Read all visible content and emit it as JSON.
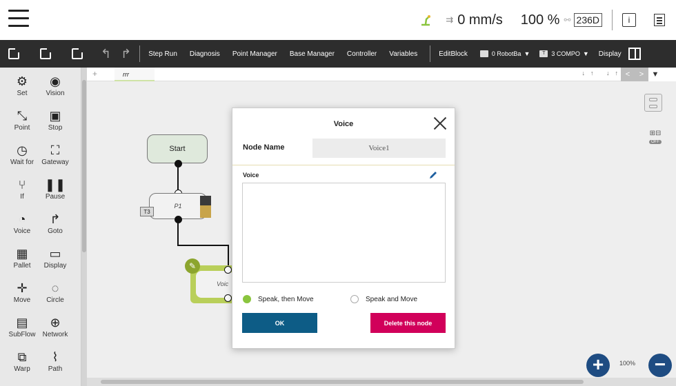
{
  "status": {
    "speed": "0 mm/s",
    "override_percent": "100 %",
    "box_value": "236D",
    "info_glyph": "i",
    "robot_icon": "robot-arm-icon",
    "accent_green": "#8ac53e"
  },
  "toolbar": {
    "items": [
      "Step Run",
      "Diagnosis",
      "Point Manager",
      "Base Manager",
      "Controller",
      "Variables"
    ],
    "edit_block": "EditBlock",
    "base_select": "0 RobotBa",
    "tool_select": "3 COMPO",
    "tool_prefix": "T",
    "display": "Display"
  },
  "palette": [
    {
      "label": "Set",
      "glyph": "⚙"
    },
    {
      "label": "Vision",
      "glyph": "◉"
    },
    {
      "label": "Point",
      "glyph": "⤡"
    },
    {
      "label": "Stop",
      "glyph": "▣"
    },
    {
      "label": "Wait for",
      "glyph": "◷"
    },
    {
      "label": "Gateway",
      "glyph": "⛶"
    },
    {
      "label": "If",
      "glyph": "⑂"
    },
    {
      "label": "Pause",
      "glyph": "❚❚"
    },
    {
      "label": "Voice",
      "glyph": "◔"
    },
    {
      "label": "Goto",
      "glyph": "↱"
    },
    {
      "label": "Pallet",
      "glyph": "▦"
    },
    {
      "label": "Display",
      "glyph": "▭"
    },
    {
      "label": "Move",
      "glyph": "✛"
    },
    {
      "label": "Circle",
      "glyph": "◌"
    },
    {
      "label": "SubFlow",
      "glyph": "▤"
    },
    {
      "label": "Network",
      "glyph": "⊕"
    },
    {
      "label": "Warp",
      "glyph": "⧉"
    },
    {
      "label": "Path",
      "glyph": "⌇"
    }
  ],
  "canvas": {
    "tab_name": "rrr",
    "tab_tools": "↓↑ ↓↑ ⊕",
    "nodes": {
      "start": "Start",
      "p1": "P1",
      "t3": "T3",
      "voice_partial": "Voic"
    },
    "zoom": "100%"
  },
  "dialog": {
    "title": "Voice",
    "node_name_label": "Node Name",
    "node_name_value": "Voice1",
    "voice_label": "Voice",
    "voice_text": "",
    "option_1": "Speak, then Move",
    "option_2": "Speak and Move",
    "selected": "Speak, then Move",
    "ok_label": "OK",
    "delete_label": "Delete this node",
    "ok_color": "#0d5c86",
    "delete_color": "#d1005a"
  }
}
